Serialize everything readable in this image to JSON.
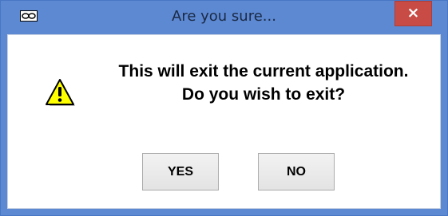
{
  "window": {
    "title": "Are you sure...",
    "close_label": "×"
  },
  "dialog": {
    "icon": "warning-icon",
    "message_line1": "This will exit the current application.",
    "message_line2": "Do you wish to exit?",
    "buttons": {
      "yes": "YES",
      "no": "NO"
    }
  },
  "colors": {
    "titlebar": "#5d89d3",
    "close_button": "#c94b45",
    "warning_fill": "#ffff00"
  }
}
